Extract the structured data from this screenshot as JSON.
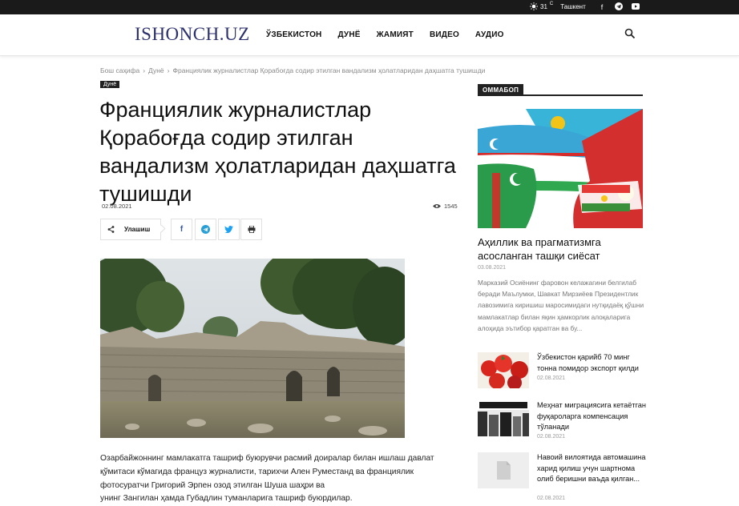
{
  "topbar": {
    "temperature": "31",
    "unit": "C",
    "city": "Ташкент"
  },
  "header": {
    "logo": "ISHONCH.UZ",
    "nav": [
      "ЎЗБЕКИСТОН",
      "ДУНЁ",
      "ЖАМИЯТ",
      "ВИДЕО",
      "АУДИО"
    ]
  },
  "breadcrumb": [
    "Бош саҳифа",
    "Дунё",
    "Франциялик журналистлар Қорабоғда содир этилган вандализм ҳолатларидан даҳшатга тушишди"
  ],
  "article": {
    "category": "Дунё",
    "title": "Франциялик журналистлар Қорабоғда содир этилган вандализм ҳолатларидан даҳшатга тушишди",
    "date": "02.08.2021",
    "views": "1545",
    "share_label": "Улашиш",
    "body_lines": [
      "Озарбайжоннинг мамлакатга ташриф буюрувчи расмий доиралар билан ишлаш давлат",
      "қўмитаси кўмагида француз журналисти, тарихчи Ален Руместанд ва франциялик",
      "фотосуратчи Григорий Эрпен озод этилган Шуша шаҳри ва",
      "унинг Зангилан ҳамда Губадлин туманларига ташриф буюрдилар."
    ]
  },
  "sidebar": {
    "block_title": "ОММАБОП",
    "featured": {
      "title": "Аҳиллик ва прагматизмга асосланган ташқи сиёсат",
      "date": "03.08.2021",
      "excerpt": "Марказий Осиёнинг фаровон келажагини белгилаб беради Маълумки, Шавкат Мирзиёев Президентлик лавозимига киришиш маросимидаги нутқидаёқ қўшни мамлакатлар билан яқин ҳамкорлик алоқаларига алоҳида эътибор қаратган ва бу..."
    },
    "items": [
      {
        "title": "Ўзбекистон қарийб 70 минг тонна помидор экспорт қилди",
        "date": "02.08.2021"
      },
      {
        "title": "Меҳнат миграциясига кетаётган фуқароларга компенсация тўланади",
        "date": "02.08.2021"
      },
      {
        "title": "Навоий вилоятида автомашина харид қилиш учун шартнома олиб беришни ваъда қилган...",
        "date": "02.08.2021"
      }
    ]
  },
  "colors": {
    "logo": "#2b2f6b",
    "dark": "#222222",
    "facebook": "#3b5998",
    "telegram": "#2a9fd6",
    "twitter": "#1da1f2"
  }
}
